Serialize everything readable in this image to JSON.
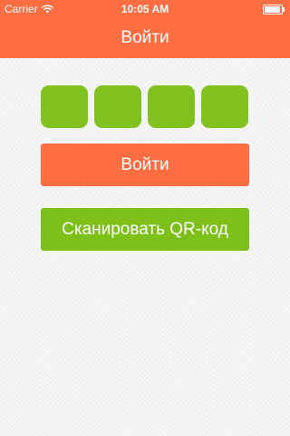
{
  "status_bar": {
    "carrier": "Carrier",
    "time": "10:05 AM",
    "signal_icon": "wifi-icon",
    "battery_icon": "battery-icon",
    "battery_level": 1.0
  },
  "nav": {
    "title": "Войти"
  },
  "code_entry": {
    "box_count": 4,
    "values": [
      "",
      "",
      "",
      ""
    ]
  },
  "buttons": {
    "login_label": "Войти",
    "scan_label": "Сканировать QR-код"
  },
  "colors": {
    "accent_orange": "#ff6e43",
    "accent_green": "#7ec01a",
    "background": "#f6f6f6",
    "text_on_accent": "#ffffff"
  }
}
